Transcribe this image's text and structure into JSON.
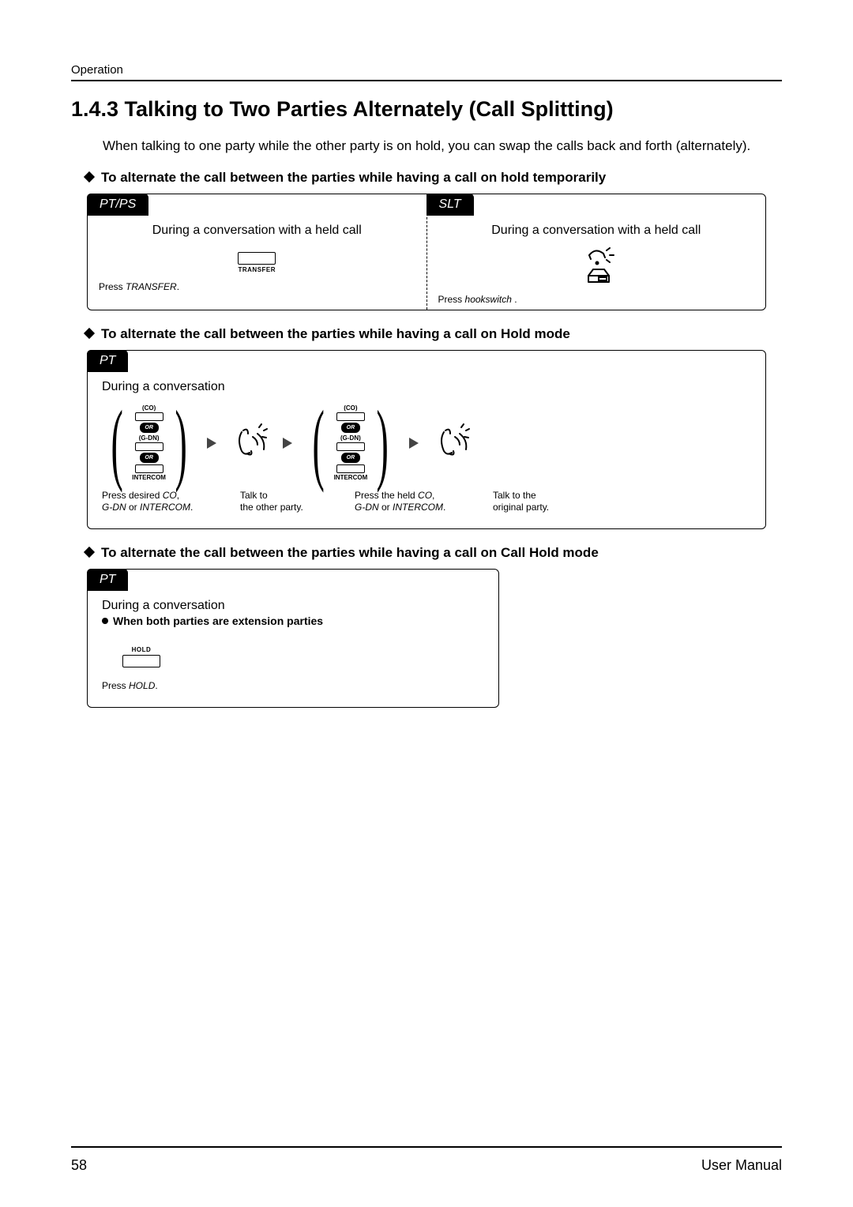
{
  "header": {
    "breadcrumb": "Operation"
  },
  "title": "1.4.3   Talking to Two Parties Alternately (Call Splitting)",
  "intro": "When talking to one party while the other party is on hold, you can swap the calls back and forth (alternately).",
  "sec1": {
    "heading": "To alternate the call between the parties while having a call on hold temporarily",
    "left": {
      "tab": "PT/PS",
      "during": "During a conversation with a held call",
      "key_label": "TRANSFER",
      "caption_pre": "Press ",
      "caption_it": "TRANSFER",
      "caption_post": "."
    },
    "right": {
      "tab": "SLT",
      "during": "During a conversation with a held call",
      "caption_pre": "Press ",
      "caption_it": "hookswitch",
      "caption_post": " ."
    }
  },
  "sec2": {
    "heading": "To alternate the call between the parties while having a call on Hold mode",
    "tab": "PT",
    "during": "During a conversation",
    "keys": {
      "co": "(CO)",
      "or": "OR",
      "gdn": "(G-DN)",
      "intercom": "INTERCOM"
    },
    "cap1_l1": "Press desired ",
    "cap1_co": "CO",
    "cap1_l2a": "G-DN",
    "cap1_l2b": " or ",
    "cap1_l2c": "INTERCOM",
    "cap2_l1": "Talk to",
    "cap2_l2": "the other party.",
    "cap3_l1": "Press the held ",
    "cap3_co": "CO",
    "cap4_l1": "Talk to the",
    "cap4_l2": "original party."
  },
  "sec3": {
    "heading": "To alternate the call between the parties while having a call on Call Hold mode",
    "tab": "PT",
    "during": "During a conversation",
    "condition": "When both parties are extension parties",
    "key_label": "HOLD",
    "caption_pre": "Press ",
    "caption_it": "HOLD",
    "caption_post": "."
  },
  "footer": {
    "page": "58",
    "title": "User Manual"
  }
}
